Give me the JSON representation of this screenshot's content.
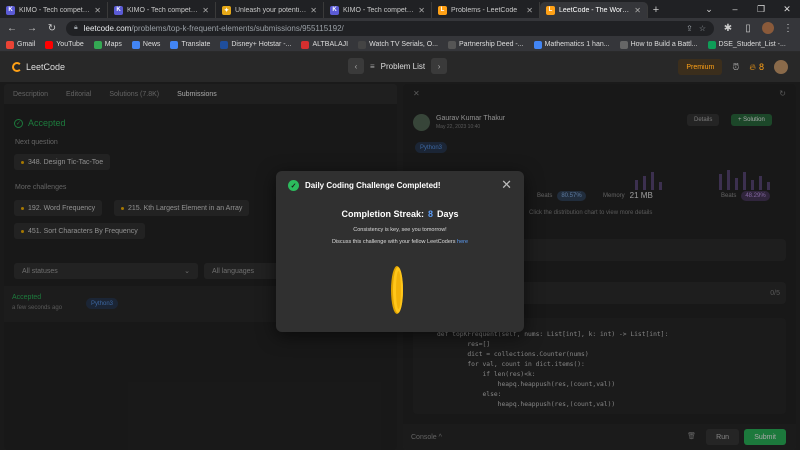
{
  "browser": {
    "tabs": [
      {
        "title": "KIMO - Tech competition",
        "fav": "K",
        "color": "#5b5bd6",
        "active": false
      },
      {
        "title": "KIMO - Tech competition",
        "fav": "K",
        "color": "#5b5bd6",
        "active": false
      },
      {
        "title": "Unleash your potential w",
        "fav": "✦",
        "color": "#e6a817",
        "active": false
      },
      {
        "title": "KIMO - Tech competition",
        "fav": "K",
        "color": "#5b5bd6",
        "active": false
      },
      {
        "title": "Problems - LeetCode",
        "fav": "L",
        "color": "#ffa116",
        "active": false
      },
      {
        "title": "LeetCode - The World's Le",
        "fav": "L",
        "color": "#ffa116",
        "active": true
      }
    ],
    "url_host": "leetcode.com",
    "url_path": "/problems/top-k-frequent-elements/submissions/955115192/",
    "bookmarks": [
      {
        "label": "Gmail",
        "color": "#ea4335"
      },
      {
        "label": "YouTube",
        "color": "#ff0000"
      },
      {
        "label": "Maps",
        "color": "#34a853"
      },
      {
        "label": "News",
        "color": "#4285f4"
      },
      {
        "label": "Translate",
        "color": "#4285f4"
      },
      {
        "label": "Disney+ Hotstar -...",
        "color": "#1f4e9c"
      },
      {
        "label": "ALTBALAJI",
        "color": "#d32f2f"
      },
      {
        "label": "Watch TV Serials, O...",
        "color": "#444"
      },
      {
        "label": "Partnership Deed -...",
        "color": "#555"
      },
      {
        "label": "Mathematics 1 han...",
        "color": "#4285f4"
      },
      {
        "label": "How to Build a Battl...",
        "color": "#666"
      },
      {
        "label": "DSE_Student_List -...",
        "color": "#0f9d58"
      }
    ]
  },
  "header": {
    "logo": "LeetCode",
    "problem_list": "Problem List",
    "premium": "Premium",
    "streak": "8"
  },
  "left": {
    "tabs": [
      "Description",
      "Editorial",
      "Solutions (7.8K)",
      "Submissions"
    ],
    "status": "Accepted",
    "next_question_label": "Next question",
    "next_question": "348. Design Tic-Tac-Toe",
    "more_challenges_label": "More challenges",
    "challenges": [
      "192. Word Frequency",
      "215. Kth Largest Element in an Array",
      "451. Sort Characters By Frequency"
    ],
    "filter_status": "All statuses",
    "filter_lang": "All languages",
    "submission": {
      "status": "Accepted",
      "time": "a few seconds ago",
      "lang": "Python3"
    }
  },
  "right": {
    "author": "Gaurav Kumar Thakur",
    "date": "May 22, 2023 10:40",
    "details_label": "Details",
    "solution_label": "+ Solution",
    "lang": "Python3",
    "runtime_beats_label": "Beats",
    "runtime_beats": "80.57%",
    "memory_label": "Memory",
    "memory_value": "21 MB",
    "memory_beats_label": "Beats",
    "memory_beats": "48.29%",
    "dist_note": "Click the distribution chart to view more details",
    "notes_count": "0/5",
    "code": [
      "def topKFrequent(self, nums: List[int], k: int) -> List[int]:",
      "        res=[]",
      "        dict = collections.Counter(nums)",
      "        for val, count in dict.items():",
      "            if len(res)<k:",
      "                heapq.heappush(res,(count,val))",
      "            else:",
      "                heapq.heappush(res,(count,val))"
    ],
    "console_label": "Console ^",
    "run_label": "Run",
    "submit_label": "Submit"
  },
  "modal": {
    "title": "Daily Coding Challenge Completed!",
    "streak_label": "Completion Streak:",
    "streak_count": "8",
    "streak_unit": "Days",
    "message1": "Consistency is key, see you tomorrow!",
    "message2": "Discuss this challenge with your fellow LeetCoders",
    "link_label": "here"
  },
  "colors": {
    "accent": "#ffa116",
    "success": "#2cbb5d",
    "link": "#5c9cf5"
  }
}
